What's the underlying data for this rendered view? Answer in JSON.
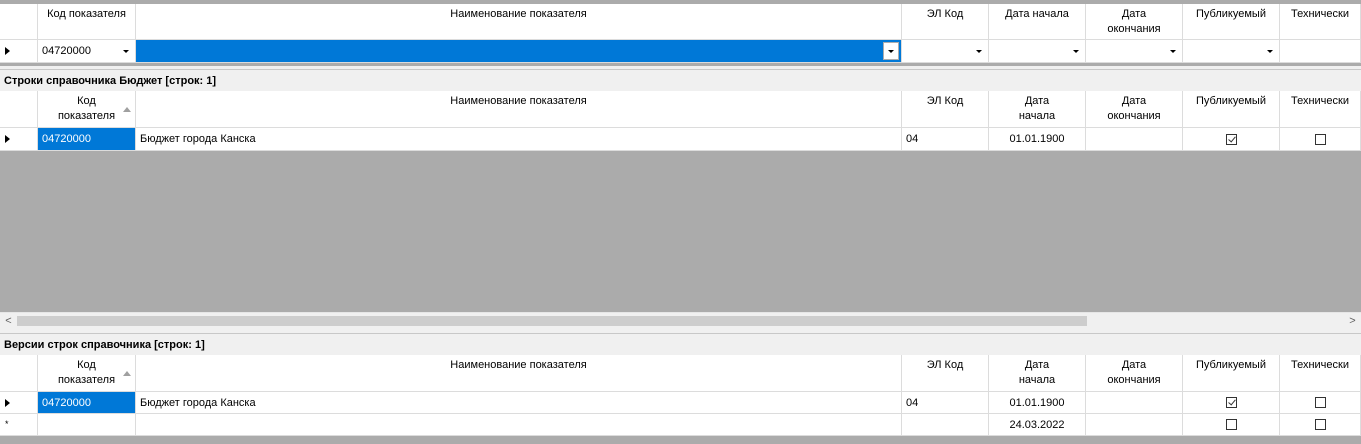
{
  "filter_grid": {
    "headers": [
      "Код показателя",
      "Наименование показателя",
      "ЭЛ Код",
      "Дата начала",
      "Дата\nокончания",
      "Публикуемый",
      "Технически"
    ],
    "row": {
      "code": "04720000",
      "name": "",
      "el_code": "",
      "date_start": "",
      "date_end": "",
      "published": ""
    }
  },
  "rows_grid": {
    "caption": "Строки справочника Бюджет [строк: 1]",
    "headers": [
      "Код\nпоказателя",
      "Наименование показателя",
      "ЭЛ Код",
      "Дата\nначала",
      "Дата\nокончания",
      "Публикуемый",
      "Технически"
    ],
    "rows": [
      {
        "code": "04720000",
        "name": "Бюджет города Канска",
        "el_code": "04",
        "date_start": "01.01.1900",
        "date_end": "",
        "published": true,
        "technical": false
      }
    ],
    "scroll_left": "<",
    "scroll_right": ">"
  },
  "versions_grid": {
    "caption": "Версии строк справочника [строк: 1]",
    "headers": [
      "Код\nпоказателя",
      "Наименование показателя",
      "ЭЛ Код",
      "Дата\nначала",
      "Дата\nокончания",
      "Публикуемый",
      "Технически"
    ],
    "rows": [
      {
        "code": "04720000",
        "name": "Бюджет города Канска",
        "el_code": "04",
        "date_start": "01.01.1900",
        "date_end": "",
        "published": true,
        "technical": false
      }
    ],
    "new_row": {
      "date_start": "24.03.2022",
      "published": false,
      "technical": false
    }
  }
}
